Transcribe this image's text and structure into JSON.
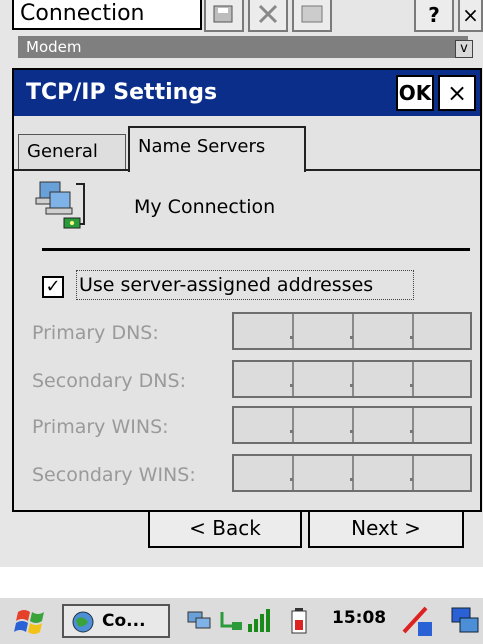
{
  "background_window": {
    "title": "Connection",
    "subtitle": "Modem"
  },
  "dialog": {
    "title": "TCP/IP Settings",
    "ok_label": "OK",
    "close_label": "×",
    "tabs": [
      {
        "label": "General",
        "active": false
      },
      {
        "label": "Name Servers",
        "active": true
      }
    ],
    "connection_name": "My Connection",
    "use_server_assigned": {
      "label": "Use server-assigned addresses",
      "checked": true
    },
    "fields": [
      {
        "label": "Primary DNS:",
        "value": [
          "",
          "",
          "",
          ""
        ]
      },
      {
        "label": "Secondary DNS:",
        "value": [
          "",
          "",
          "",
          ""
        ]
      },
      {
        "label": "Primary WINS:",
        "value": [
          "",
          "",
          "",
          ""
        ]
      },
      {
        "label": "Secondary WINS:",
        "value": [
          "",
          "",
          "",
          ""
        ]
      }
    ]
  },
  "wizard_nav": {
    "back_label": "< Back",
    "next_label": "Next >"
  },
  "taskbar": {
    "task_label": "Co...",
    "time": "15:08"
  },
  "colors": {
    "title_bar": "#0a2e8a",
    "dialog_bg": "#e3e3e3",
    "disabled_text": "#9a9a9a"
  }
}
